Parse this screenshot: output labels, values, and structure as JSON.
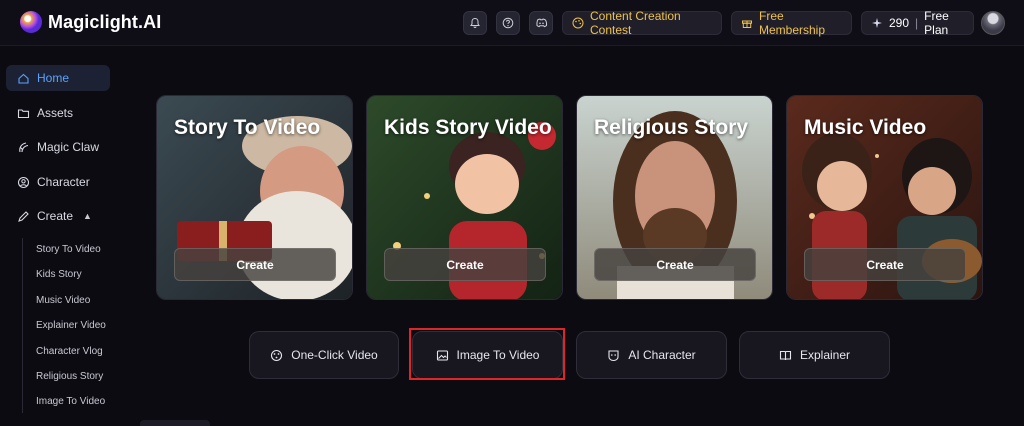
{
  "app": {
    "name": "Magiclight.AI"
  },
  "header": {
    "icons": [
      "bell-icon",
      "help-icon",
      "discord-icon"
    ],
    "contest_label": "Content Creation Contest",
    "membership_label": "Free Membership",
    "credits": "290",
    "plan": "Free Plan",
    "accent": "#f0c24b"
  },
  "sidebar": {
    "items": [
      {
        "label": "Home",
        "icon": "home-icon",
        "active": true
      },
      {
        "label": "Assets",
        "icon": "folder-icon"
      },
      {
        "label": "Magic Claw",
        "icon": "claw-icon"
      },
      {
        "label": "Character",
        "icon": "character-icon"
      },
      {
        "label": "Create",
        "icon": "create-icon",
        "expanded": true
      }
    ],
    "create_sub": [
      "Story To Video",
      "Kids Story",
      "Music Video",
      "Explainer Video",
      "Character Vlog",
      "Religious Story",
      "Image To Video"
    ],
    "active_color": "#5aa2ff"
  },
  "cards": [
    {
      "title": "Story To Video",
      "button": "Create"
    },
    {
      "title": "Kids Story Video",
      "button": "Create"
    },
    {
      "title": "Religious Story",
      "button": "Create"
    },
    {
      "title": "Music Video",
      "button": "Create"
    }
  ],
  "features": [
    {
      "label": "One-Click Video",
      "icon": "sparkle-film-icon"
    },
    {
      "label": "Image To Video",
      "icon": "image-icon",
      "highlighted": true
    },
    {
      "label": "AI Character",
      "icon": "character-face-icon"
    },
    {
      "label": "Explainer",
      "icon": "book-icon"
    }
  ],
  "highlight_color": "#e0252a"
}
